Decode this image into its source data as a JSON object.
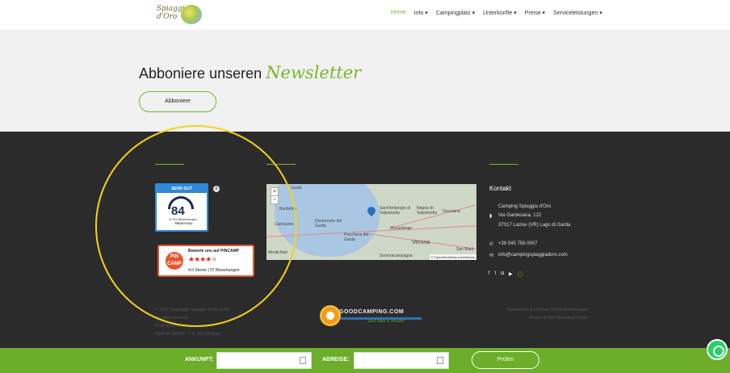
{
  "logo": {
    "text": "Spiaggia d'Oro"
  },
  "nav": [
    {
      "label": "Home"
    },
    {
      "label": "Info ▾"
    },
    {
      "label": "Campingplatz ▾"
    },
    {
      "label": "Unterkünfte ▾"
    },
    {
      "label": "Preise ▾"
    },
    {
      "label": "Serviceleistungen ▾"
    }
  ],
  "newsletter": {
    "title_prefix": "Abboniere unseren",
    "title_script": "Newsletter",
    "button": "Abboniere"
  },
  "trustyou": {
    "badge": "SEHR GUT",
    "score": "84",
    "reviews": "8,791 Bewertungen",
    "brand": "TRUSTYOU",
    "info": "i"
  },
  "pincamp": {
    "logo": "PiN CAMP",
    "title": "Bewerte uns auf PINCAMP",
    "rating": 4.0,
    "rating_text": "4.0 Sterne | 97 Bewertungen"
  },
  "map": {
    "zoom_in": "+",
    "zoom_out": "−",
    "places": [
      "Garda",
      "Bardolino",
      "Calmasino",
      "Desenzano del Garda",
      "Peschiera del Garda",
      "Sant'Ambrogio di Valpolicella",
      "Negrar di Valpolicella",
      "Grezzana",
      "Bussolengo",
      "Verona",
      "San Marti",
      "Sommacampagna",
      "Montichiari"
    ],
    "attribution": "© OpenStreetMap contributors"
  },
  "kontakt": {
    "title": "Kontakt",
    "name": "Camping Spiaggia d'Oro",
    "street": "Via Gardesana, 122",
    "city": "37017 Lazise (VR) Lago di Garda",
    "phone": "+39 045 758 0007",
    "email": "info@campingspiaggiadoro.com"
  },
  "footer": {
    "copyright": "© 2017 Campeggio Spiaggia D'Oro S.P.A.",
    "rights": "All rights reserved",
    "piva": "P.IVA 00254830232",
    "rea": "REA VR 236367 - C.S. 112.000 Euro",
    "links1": "Datenschutz & Cookies   Cookie-Einstellungen",
    "links2": "Project & Web Marketing   Credits",
    "brand_name": "GOODCAMPING.COM",
    "brand_tag": "just take a dream"
  },
  "booking": {
    "arrival_label": "ANKUNFT:",
    "departure_label": "ABREISE:",
    "button": "Prüfen"
  },
  "colors": {
    "accent": "#75b72b",
    "footer_bg": "#2b2b2b",
    "booking_bg": "#6cae2a",
    "highlight": "#f4d21a"
  }
}
